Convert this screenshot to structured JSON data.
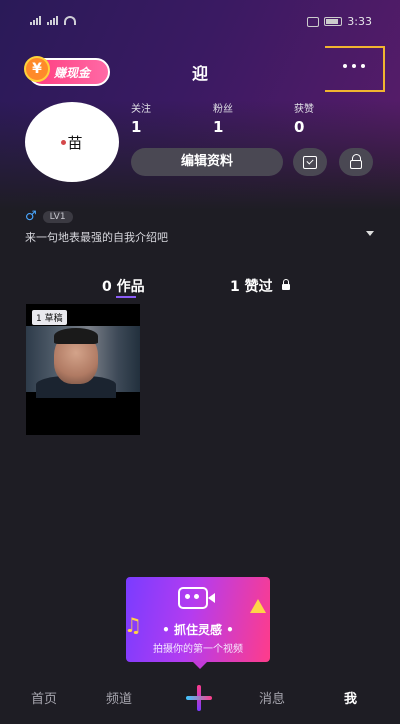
{
  "status_bar": {
    "time": "3:33"
  },
  "header": {
    "earn_badge_label": "赚现金",
    "earn_icon_glyph": "¥",
    "username": "迎"
  },
  "profile": {
    "avatar_text": "苗",
    "stats": [
      {
        "label": "关注",
        "value": "1"
      },
      {
        "label": "粉丝",
        "value": "1"
      },
      {
        "label": "获赞",
        "value": "0"
      }
    ],
    "edit_label": "编辑资料",
    "gender_symbol": "♂",
    "level": "LV1",
    "bio": "来一句地表最强的自我介绍吧"
  },
  "tabs": [
    {
      "label": "0 作品"
    },
    {
      "label": "1 赞过"
    }
  ],
  "video": {
    "badge": "1 草稿"
  },
  "promo": {
    "title": "• 抓住灵感 •",
    "subtitle": "拍摄你的第一个视频",
    "music_glyph": "♫"
  },
  "bottom_nav": [
    {
      "label": "首页"
    },
    {
      "label": "频道"
    },
    {
      "label": "消息"
    },
    {
      "label": "我"
    }
  ],
  "colors": {
    "accent": "#8b5cf6",
    "highlight_box": "#f1b530",
    "promo_pink": "#ff3c8a",
    "gender": "#4aa7ff"
  }
}
